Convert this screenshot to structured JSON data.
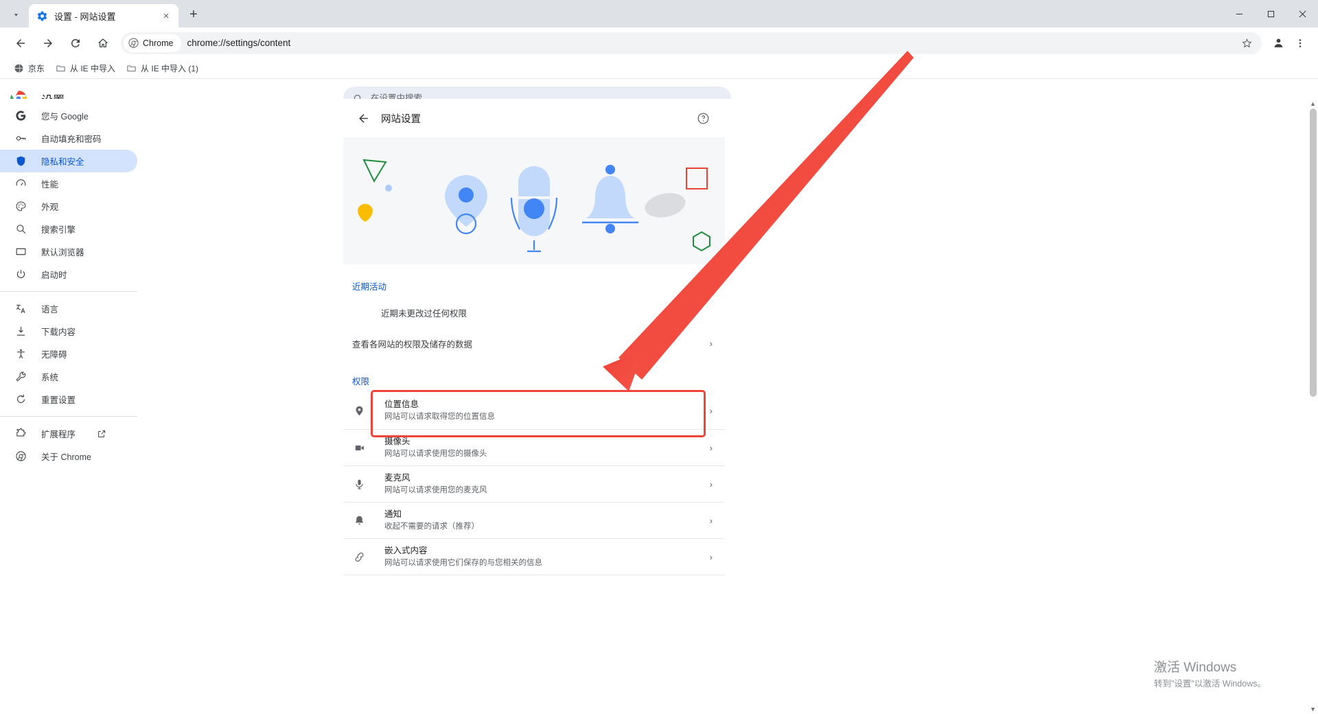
{
  "window": {
    "tab": {
      "title": "设置 - 网站设置",
      "favicon": "gear-icon",
      "close": "×"
    },
    "new_tab_label": "+",
    "controls": {
      "minimize": "—",
      "maximize": "▢",
      "close": "✕"
    }
  },
  "toolbar": {
    "back": "←",
    "forward": "→",
    "reload": "⟳",
    "home": "⌂",
    "chrome_chip_label": "Chrome",
    "url": "chrome://settings/content",
    "star": "☆",
    "profile": "profile-icon",
    "menu": "⋮"
  },
  "bookmarks": [
    {
      "label": "京东",
      "icon": "globe-icon"
    },
    {
      "label": "从 IE 中导入",
      "icon": "folder-icon"
    },
    {
      "label": "从 IE 中导入 (1)",
      "icon": "folder-icon"
    }
  ],
  "settings_header": {
    "title": "设置",
    "search_placeholder": "在设置中搜索",
    "search_value": ""
  },
  "sidebar": {
    "items": [
      {
        "label": "您与 Google",
        "icon": "google-g-icon",
        "active": false
      },
      {
        "label": "自动填充和密码",
        "icon": "key-icon",
        "active": false
      },
      {
        "label": "隐私和安全",
        "icon": "shield-icon",
        "active": true
      },
      {
        "label": "性能",
        "icon": "speedometer-icon",
        "active": false
      },
      {
        "label": "外观",
        "icon": "palette-icon",
        "active": false
      },
      {
        "label": "搜索引擎",
        "icon": "search-icon",
        "active": false
      },
      {
        "label": "默认浏览器",
        "icon": "browser-window-icon",
        "active": false
      },
      {
        "label": "启动时",
        "icon": "power-icon",
        "active": false
      }
    ],
    "items_group2": [
      {
        "label": "语言",
        "icon": "translate-icon"
      },
      {
        "label": "下载内容",
        "icon": "download-icon"
      },
      {
        "label": "无障碍",
        "icon": "accessibility-icon"
      },
      {
        "label": "系统",
        "icon": "wrench-icon"
      },
      {
        "label": "重置设置",
        "icon": "reset-icon"
      }
    ],
    "items_group3": [
      {
        "label": "扩展程序",
        "icon": "extension-icon",
        "external": true,
        "external_icon": "open-in-new-icon"
      },
      {
        "label": "关于 Chrome",
        "icon": "chrome-icon",
        "external": false
      }
    ]
  },
  "page": {
    "title": "网站设置",
    "back_icon": "back-arrow-icon",
    "help_icon": "help-circle-icon",
    "recent_activity": {
      "label": "近期活动",
      "empty_text": "近期未更改过任何权限"
    },
    "view_all_row": {
      "label": "查看各网站的权限及储存的数据",
      "chevron": "›"
    },
    "permissions_label": "权限",
    "permissions": [
      {
        "title": "位置信息",
        "desc": "网站可以请求取得您的位置信息",
        "icon": "location-pin-icon",
        "chevron": "›",
        "highlighted": true
      },
      {
        "title": "摄像头",
        "desc": "网站可以请求使用您的摄像头",
        "icon": "camera-icon",
        "chevron": "›",
        "highlighted": false
      },
      {
        "title": "麦克风",
        "desc": "网站可以请求使用您的麦克风",
        "icon": "microphone-icon",
        "chevron": "›",
        "highlighted": false
      },
      {
        "title": "通知",
        "desc": "收起不需要的请求（推荐）",
        "icon": "bell-icon",
        "chevron": "›",
        "highlighted": false
      },
      {
        "title": "嵌入式内容",
        "desc": "网站可以请求使用它们保存的与您相关的信息",
        "icon": "embedded-content-icon",
        "chevron": "›",
        "highlighted": false
      }
    ]
  },
  "annotation": {
    "arrow_color": "#f0493c",
    "box_color": "#f04438"
  },
  "watermark": {
    "title": "激活 Windows",
    "subtitle": "转到\"设置\"以激活 Windows。"
  },
  "colors": {
    "accent": "#0b57d0",
    "tabstrip_bg": "#dee1e6",
    "active_nav_bg": "#d3e3fd",
    "banner_bg": "#f5f7f9",
    "illustration_blue": "#aecbfa",
    "illustration_blue_strong": "#4285f4",
    "illustration_green": "#1e8e3e",
    "illustration_yellow": "#fbbc04",
    "illustration_red": "#ea4335",
    "illustration_gray": "#dadce0"
  }
}
